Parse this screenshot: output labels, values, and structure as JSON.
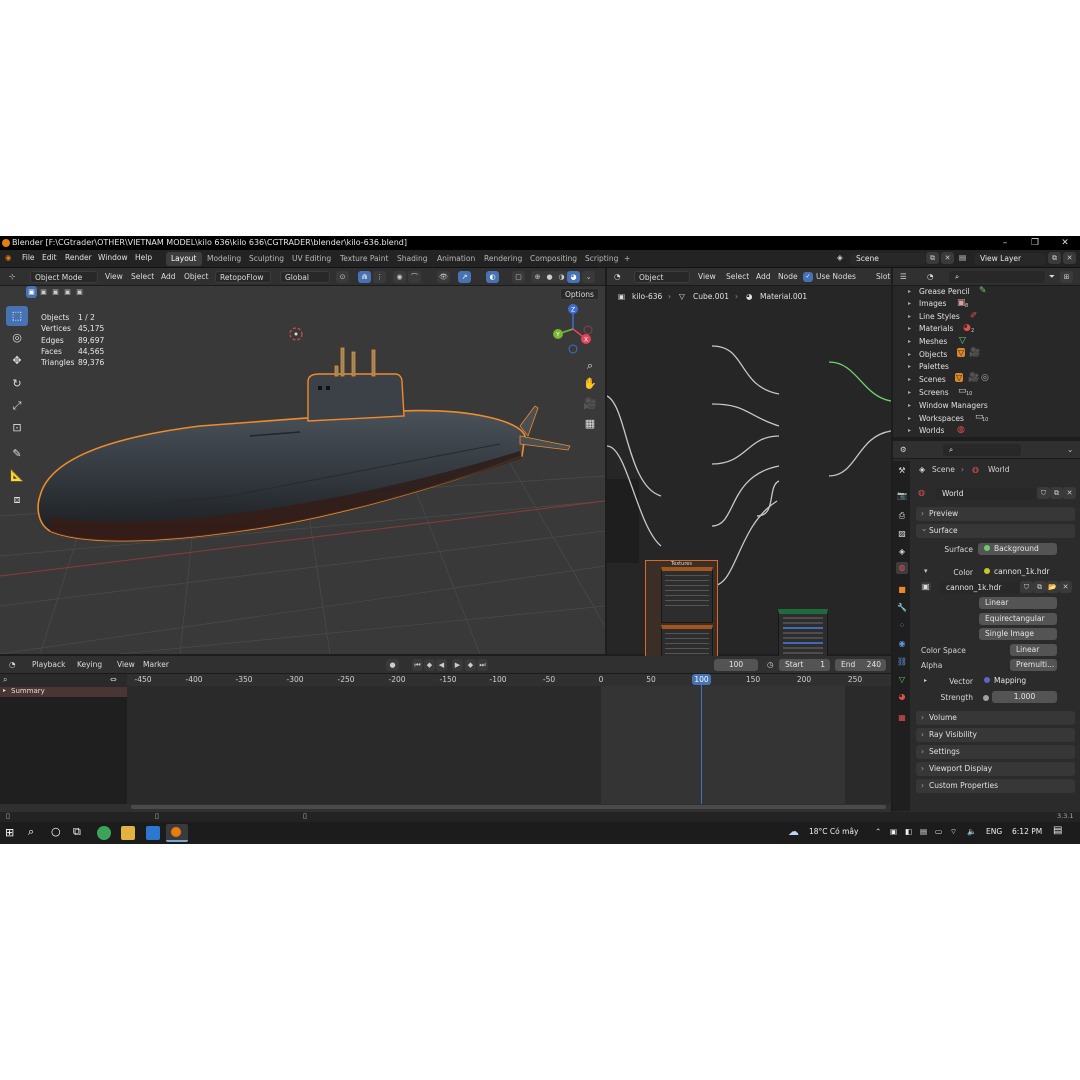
{
  "window": {
    "title": "Blender [F:\\CGtrader\\OTHER\\VIETNAM MODEL\\kilo 636\\kilo 636\\CGTRADER\\blender\\kilo-636.blend]",
    "minimize": "–",
    "maximize": "❐",
    "close": "✕"
  },
  "menu": {
    "items": [
      "File",
      "Edit",
      "Render",
      "Window",
      "Help"
    ]
  },
  "workspaces": [
    "Layout",
    "Modeling",
    "Sculpting",
    "UV Editing",
    "Texture Paint",
    "Shading",
    "Animation",
    "Rendering",
    "Compositing",
    "Scripting"
  ],
  "workspace_add": "+",
  "scene": {
    "scene_name": "Scene",
    "view_layer": "View Layer"
  },
  "viewport": {
    "mode": "Object Mode",
    "menus": [
      "View",
      "Select",
      "Add",
      "Object"
    ],
    "addon": "RetopoFlow",
    "orientation": "Global",
    "options": "Options",
    "stats": [
      {
        "k": "Objects",
        "v": "1 / 2"
      },
      {
        "k": "Vertices",
        "v": "45,175"
      },
      {
        "k": "Edges",
        "v": "89,697"
      },
      {
        "k": "Faces",
        "v": "44,565"
      },
      {
        "k": "Triangles",
        "v": "89,376"
      }
    ],
    "gizmo": {
      "z": "Z",
      "y": "Y",
      "x": "X"
    }
  },
  "node_editor": {
    "type": "Object",
    "menus": [
      "View",
      "Select",
      "Add",
      "Node"
    ],
    "use_nodes": "Use Nodes",
    "slot": "Slot",
    "breadcrumb": [
      "kilo-636",
      "Cube.001",
      "Material.001"
    ],
    "frame_label": "Textures"
  },
  "outliner": {
    "items": [
      "Grease Pencil",
      "Images",
      "Line Styles",
      "Materials",
      "Meshes",
      "Objects",
      "Palettes",
      "Scenes",
      "Screens",
      "Window Managers",
      "Workspaces",
      "Worlds"
    ],
    "badges": {
      "images": "8",
      "materials": "2",
      "screens": "10",
      "workspaces": "10"
    }
  },
  "properties": {
    "breadcrumb": [
      "Scene",
      "World"
    ],
    "world_name": "World",
    "panels": {
      "preview": "Preview",
      "surface": "Surface",
      "volume": "Volume",
      "ray_visibility": "Ray Visibility",
      "settings": "Settings",
      "viewport_display": "Viewport Display",
      "custom_properties": "Custom Properties"
    },
    "surface_label": "Surface",
    "surface_value": "Background",
    "color_label": "Color",
    "color_value": "cannon_1k.hdr",
    "image_name": "cannon_1k.hdr",
    "interpolation": "Linear",
    "projection": "Equirectangular",
    "source": "Single Image",
    "color_space_label": "Color Space",
    "color_space": "Linear",
    "alpha_label": "Alpha",
    "alpha": "Premulti...",
    "vector_label": "Vector",
    "vector": "Mapping",
    "strength_label": "Strength",
    "strength": "1.000"
  },
  "timeline": {
    "menus": [
      "Playback",
      "Keying",
      "View",
      "Marker"
    ],
    "current_frame": "100",
    "start_label": "Start",
    "start": "1",
    "end_label": "End",
    "end": "240",
    "summary": "Summary",
    "ticks": [
      "-450",
      "-400",
      "-350",
      "-300",
      "-250",
      "-200",
      "-150",
      "-100",
      "-50",
      "0",
      "50",
      "100",
      "150",
      "200",
      "250"
    ],
    "playhead": "100"
  },
  "status": {
    "version": "3.3.1"
  },
  "taskbar": {
    "weather": "18°C  Có mây",
    "lang": "ENG",
    "time": "6:12 PM"
  }
}
